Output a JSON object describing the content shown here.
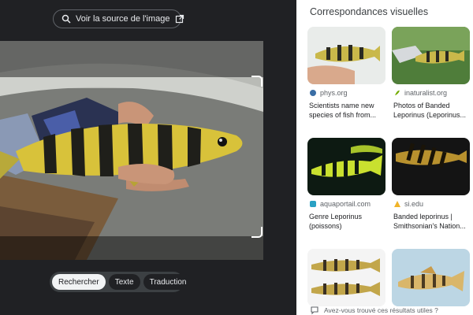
{
  "viewer": {
    "source_button_label": "Voir la source de l'image",
    "modes": [
      {
        "label": "Rechercher",
        "active": true
      },
      {
        "label": "Texte",
        "active": false
      },
      {
        "label": "Traduction",
        "active": false
      }
    ]
  },
  "results": {
    "heading": "Correspondances visuelles",
    "cards": [
      {
        "site": "phys.org",
        "title": "Scientists name new species of fish from..."
      },
      {
        "site": "inaturalist.org",
        "title": "Photos of Banded Leporinus (Leporinus..."
      },
      {
        "site": "aquaportail.com",
        "title": "Genre Leporinus (poissons)"
      },
      {
        "site": "si.edu",
        "title": "Banded leporinus | Smithsonian's Nation..."
      },
      {
        "site": "",
        "title": ""
      },
      {
        "site": "",
        "title": ""
      }
    ],
    "feedback": "Avez-vous trouvé ces résultats utiles ?"
  },
  "colors": {
    "viewer_bg": "#202124",
    "fish_yellow": "#d8c23a",
    "fish_band": "#1f1f1a"
  }
}
